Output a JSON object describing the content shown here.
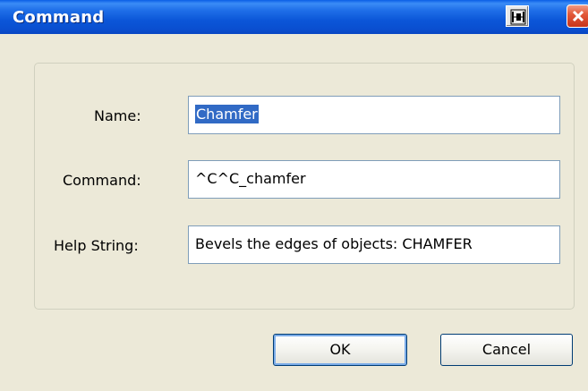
{
  "window": {
    "title": "Command"
  },
  "form": {
    "name_label": "Name:",
    "name_value": "Chamfer",
    "command_label": "Command:",
    "command_value": "^C^C_chamfer",
    "help_label": "Help String:",
    "help_value": "Bevels the edges of objects:  CHAMFER"
  },
  "buttons": {
    "ok_label": "OK",
    "cancel_label": "Cancel"
  },
  "icons": {
    "pin": "pin-icon",
    "close": "close-icon"
  },
  "colors": {
    "titlebar": "#0a5ee6",
    "selection": "#316ac5",
    "close": "#e35a3a",
    "dialog_bg": "#ece9d8"
  }
}
